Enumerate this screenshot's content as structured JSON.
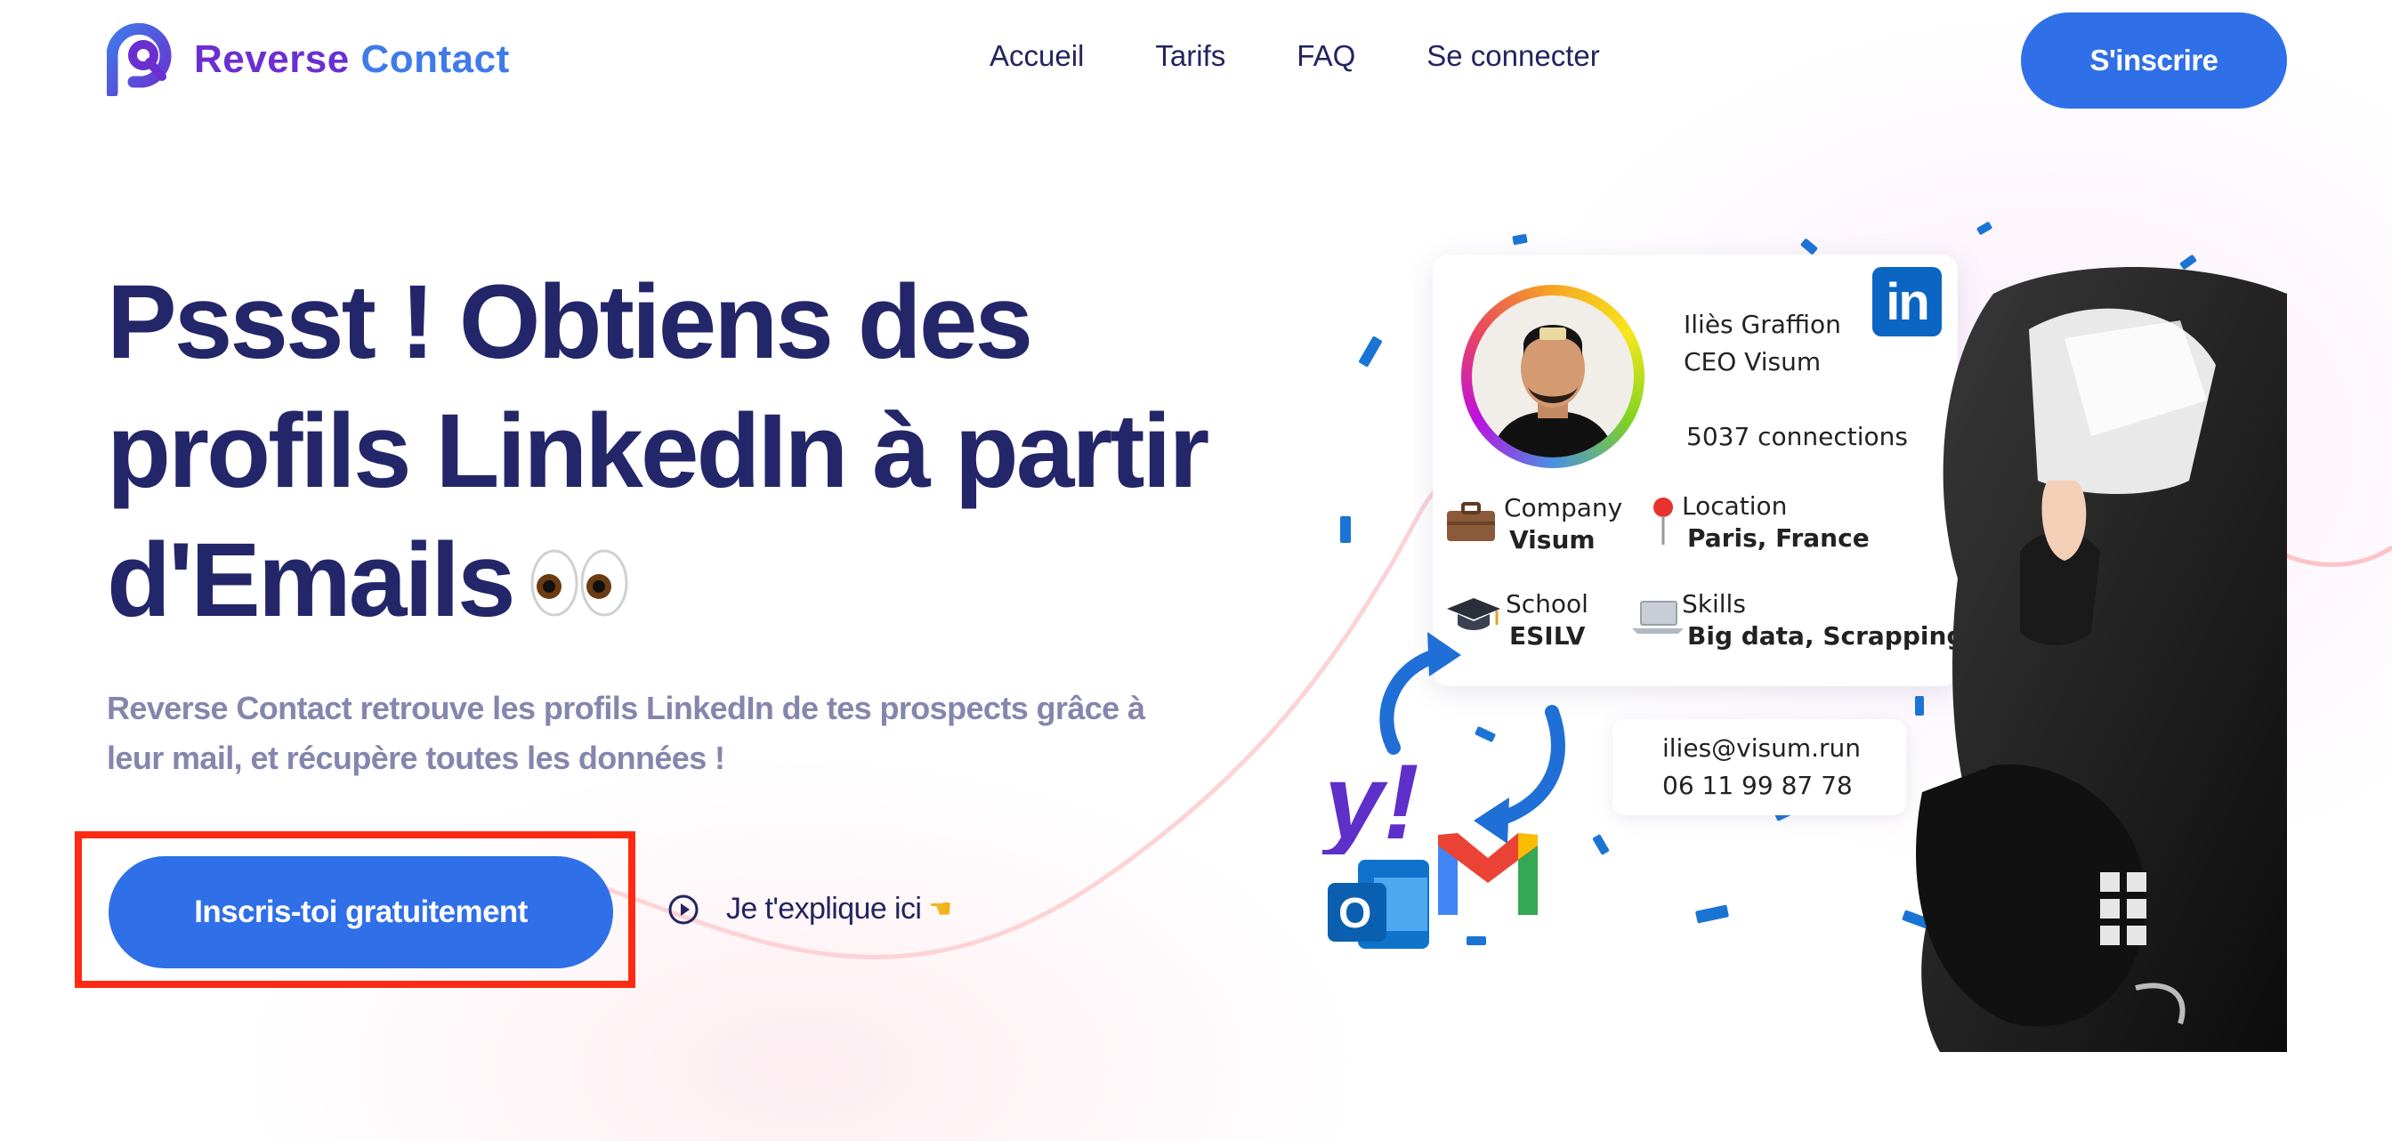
{
  "header": {
    "logo_word1": "Reverse",
    "logo_word2": "Contact",
    "nav": [
      "Accueil",
      "Tarifs",
      "FAQ",
      "Se connecter"
    ],
    "signup_label": "S'inscrire"
  },
  "hero": {
    "title_line1": "Pssst ! Obtiens des",
    "title_line2": "profils LinkedIn à partir",
    "title_line3": "d'Emails",
    "subtitle": "Reverse Contact retrouve les profils LinkedIn de tes prospects grâce à leur mail, et récupère toutes les données !",
    "cta_label": "Inscris-toi gratuitement",
    "explain_label": "Je t'explique ici"
  },
  "profile_card": {
    "name": "Iliès Graffion",
    "role": "CEO Visum",
    "connections": "5037 connections",
    "company_label": "Company",
    "company_value": "Visum",
    "location_label": "Location",
    "location_value": "Paris, France",
    "school_label": "School",
    "school_value": "ESILV",
    "skills_label": "Skills",
    "skills_value": "Big data, Scrapping",
    "linkedin_badge": "in"
  },
  "contact_box": {
    "email": "ilies@visum.run",
    "phone": "06 11 99 87 78"
  },
  "colors": {
    "primary": "#2f6fe8",
    "title": "#232668",
    "subtitle": "#8586ad",
    "highlight": "#ff2a12",
    "linkedin": "#0a66c2"
  },
  "icons": [
    "logo-mark-icon",
    "eyes-emoji-icon",
    "play-circle-icon",
    "pointing-hand-icon",
    "linkedin-icon",
    "briefcase-icon",
    "pin-icon",
    "graduation-cap-icon",
    "laptop-icon",
    "yahoo-icon",
    "gmail-icon",
    "outlook-icon",
    "refresh-arrows-icon"
  ]
}
